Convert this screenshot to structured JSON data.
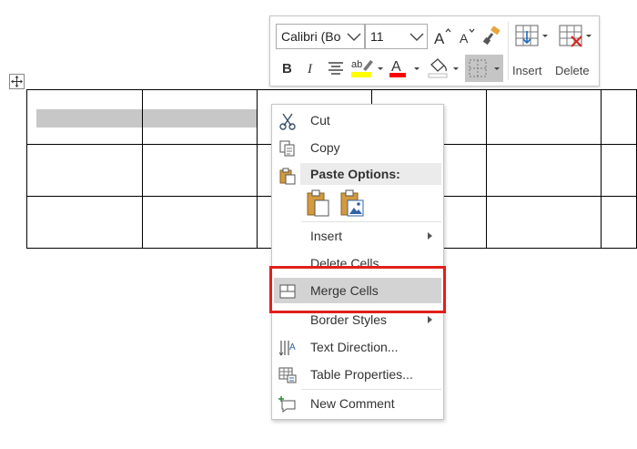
{
  "toolbar": {
    "font_name": "Calibri (Bo",
    "font_size": "11",
    "insert_label": "Insert",
    "delete_label": "Delete",
    "highlight_color": "#ffff00",
    "font_color": "#ff0000"
  },
  "context_menu": {
    "items": [
      {
        "label": "Cut",
        "icon": "scissors-icon"
      },
      {
        "label": "Copy",
        "icon": "copy-icon"
      },
      {
        "label": "Paste Options:",
        "icon": "paste-icon"
      },
      {
        "label": "Insert",
        "submenu": true
      },
      {
        "label": "Delete Cells"
      },
      {
        "label": "Merge Cells",
        "icon": "merge-cells-icon",
        "highlighted": true
      },
      {
        "label": "Border Styles",
        "submenu": true
      },
      {
        "label": "Text Direction...",
        "icon": "text-direction-icon"
      },
      {
        "label": "Table Properties...",
        "icon": "table-properties-icon"
      },
      {
        "label": "New Comment",
        "icon": "new-comment-icon"
      }
    ],
    "paste_options": [
      "keep-source-formatting-icon",
      "paste-picture-icon"
    ]
  },
  "colors": {
    "highlight_outline": "#e0201c",
    "menu_hover": "#d3d3d3"
  }
}
